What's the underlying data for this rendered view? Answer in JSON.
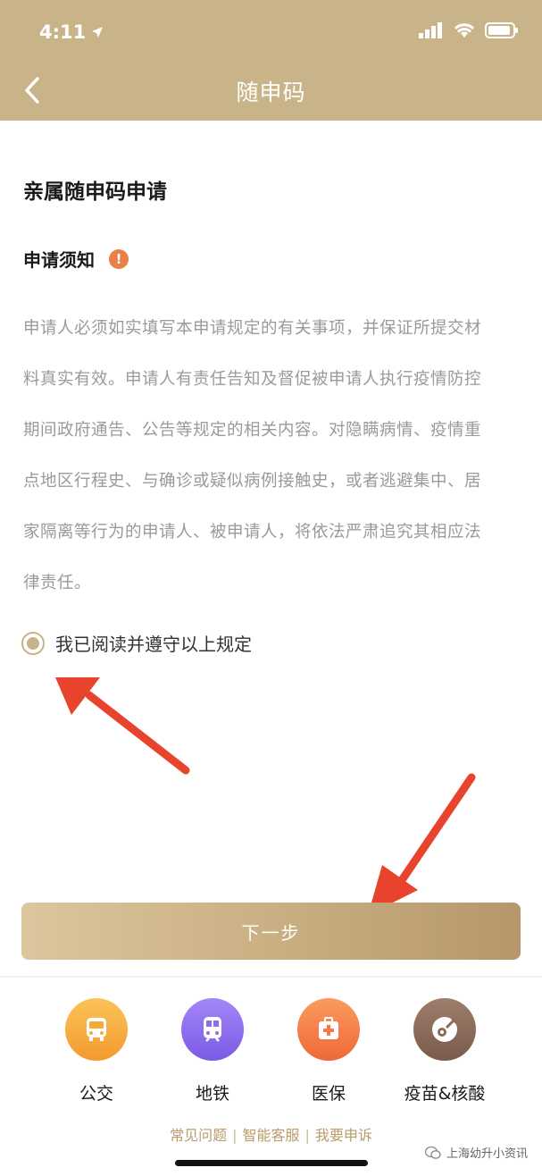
{
  "status_bar": {
    "time": "4:11"
  },
  "nav": {
    "title": "随申码"
  },
  "page": {
    "title": "亲属随申码申请",
    "notice_title": "申请须知",
    "notice_lines": [
      "申请人必须如实填写本申请规定的有关事项，并保证所提交材",
      "料真实有效。申请人有责任告知及督促被申请人执行疫情防控",
      "期间政府通告、公告等规定的相关内容。对隐瞒病情、疫情重",
      "点地区行程史、与确诊或疑似病例接触史，或者逃避集中、居",
      "家隔离等行为的申请人、被申请人，将依法严肃追究其相应法",
      "律责任。"
    ],
    "agree_label": "我已阅读并遵守以上规定",
    "agree_checked": true,
    "next_button": "下一步"
  },
  "services": [
    {
      "label": "公交",
      "icon": "bus-icon",
      "color": "#f5a93a"
    },
    {
      "label": "地铁",
      "icon": "metro-icon",
      "color": "#8c6cf0"
    },
    {
      "label": "医保",
      "icon": "medical-kit-icon",
      "color": "#f57a45"
    },
    {
      "label": "疫苗&核酸",
      "icon": "vaccine-icon",
      "color": "#8a6a5a"
    }
  ],
  "footer_links": [
    "常见问题",
    "智能客服",
    "我要申诉"
  ],
  "watermark_text": "上海幼升小资讯",
  "colors": {
    "header": "#c9b48a",
    "accent": "#c9b48a",
    "warn": "#e8804a",
    "arrow": "#e8432c"
  }
}
